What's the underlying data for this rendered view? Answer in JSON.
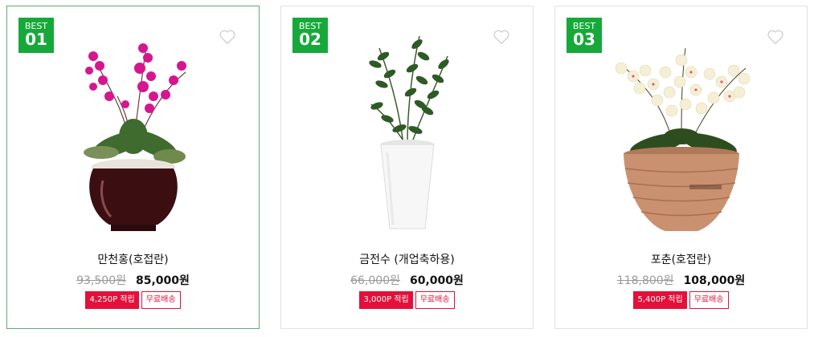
{
  "colors": {
    "badge": "#16a93a",
    "point_tag": "#e4103a",
    "active_border": "#5fae6e"
  },
  "products": [
    {
      "badge_label": "BEST",
      "rank": "01",
      "name": "만천홍(호접란)",
      "original_price": "93,500원",
      "sale_price": "85,000원",
      "points": "4,250P 적립",
      "shipping": "무료배송",
      "image": "magenta-orchid-in-brown-ceramic-pot"
    },
    {
      "badge_label": "BEST",
      "rank": "02",
      "name": "금전수 (개업축하용)",
      "original_price": "66,000원",
      "sale_price": "60,000원",
      "points": "3,000P 적립",
      "shipping": "무료배송",
      "image": "zz-plant-in-white-tall-pot"
    },
    {
      "badge_label": "BEST",
      "rank": "03",
      "name": "포춘(호접란)",
      "original_price": "118,800원",
      "sale_price": "108,000원",
      "points": "5,400P 적립",
      "shipping": "무료배송",
      "image": "white-orchid-in-wooden-pot"
    }
  ]
}
